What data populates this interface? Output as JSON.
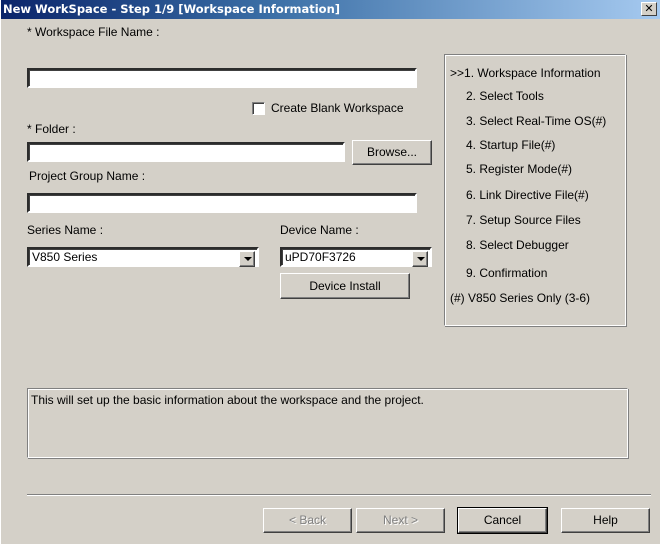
{
  "window": {
    "title": "New WorkSpace - Step 1/9 [Workspace Information]",
    "close_glyph": "✕"
  },
  "form": {
    "workspace_file_label": "* Workspace File Name :",
    "workspace_file_value": "",
    "create_blank_label": "Create Blank Workspace",
    "create_blank_checked": false,
    "folder_label": "* Folder :",
    "folder_value": "",
    "browse_label": "Browse...",
    "project_group_label": "Project Group Name :",
    "project_group_value": "",
    "series_label": "Series Name :",
    "series_value": "V850 Series",
    "device_label": "Device Name :",
    "device_value": "uPD70F3726",
    "device_install_label": "Device Install"
  },
  "steps": [
    {
      "label": ">>1. Workspace Information",
      "current": true
    },
    {
      "label": "2. Select Tools"
    },
    {
      "label": "3. Select Real-Time OS(#)"
    },
    {
      "label": "4. Startup File(#)"
    },
    {
      "label": "5. Register Mode(#)"
    },
    {
      "label": "6. Link Directive File(#)"
    },
    {
      "label": "7. Setup Source Files"
    },
    {
      "label": "8. Select Debugger"
    },
    {
      "label": "9. Confirmation"
    }
  ],
  "steps_note": "(#) V850 Series Only (3-6)",
  "description": "This will set up the basic information about the workspace and the project.",
  "buttons": {
    "back": "< Back",
    "next": "Next >",
    "cancel": "Cancel",
    "help": "Help"
  }
}
